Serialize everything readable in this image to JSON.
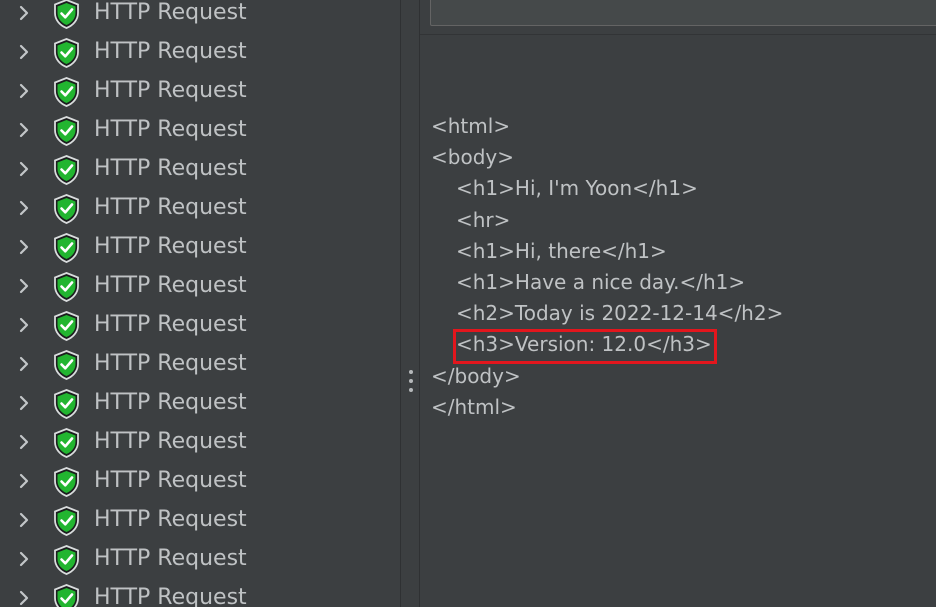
{
  "tree": {
    "items": [
      {
        "label": "HTTP Request",
        "icon": "shield-check-icon",
        "expander": "chevron-right-icon"
      },
      {
        "label": "HTTP Request",
        "icon": "shield-check-icon",
        "expander": "chevron-right-icon"
      },
      {
        "label": "HTTP Request",
        "icon": "shield-check-icon",
        "expander": "chevron-right-icon"
      },
      {
        "label": "HTTP Request",
        "icon": "shield-check-icon",
        "expander": "chevron-right-icon"
      },
      {
        "label": "HTTP Request",
        "icon": "shield-check-icon",
        "expander": "chevron-right-icon"
      },
      {
        "label": "HTTP Request",
        "icon": "shield-check-icon",
        "expander": "chevron-right-icon"
      },
      {
        "label": "HTTP Request",
        "icon": "shield-check-icon",
        "expander": "chevron-right-icon"
      },
      {
        "label": "HTTP Request",
        "icon": "shield-check-icon",
        "expander": "chevron-right-icon"
      },
      {
        "label": "HTTP Request",
        "icon": "shield-check-icon",
        "expander": "chevron-right-icon"
      },
      {
        "label": "HTTP Request",
        "icon": "shield-check-icon",
        "expander": "chevron-right-icon"
      },
      {
        "label": "HTTP Request",
        "icon": "shield-check-icon",
        "expander": "chevron-right-icon"
      },
      {
        "label": "HTTP Request",
        "icon": "shield-check-icon",
        "expander": "chevron-right-icon"
      },
      {
        "label": "HTTP Request",
        "icon": "shield-check-icon",
        "expander": "chevron-right-icon"
      },
      {
        "label": "HTTP Request",
        "icon": "shield-check-icon",
        "expander": "chevron-right-icon"
      },
      {
        "label": "HTTP Request",
        "icon": "shield-check-icon",
        "expander": "chevron-right-icon"
      },
      {
        "label": "HTTP Request",
        "icon": "shield-check-icon",
        "expander": "chevron-right-icon"
      }
    ]
  },
  "response": {
    "lines": [
      "<html>",
      "<body>",
      "<h1>Hi, I'm Yoon</h1>",
      "<hr>",
      "<h1>Hi, there</h1>",
      "<h1>Have a nice day.</h1>",
      "<h2>Today is 2022-12-14</h2>",
      "<h3>Version: 12.0</h3>",
      "</body>",
      "</html>"
    ]
  },
  "colors": {
    "background": "#3c3f41",
    "text": "#bfc2c4",
    "shield_green": "#22b530",
    "highlight_border": "#e3161d"
  }
}
